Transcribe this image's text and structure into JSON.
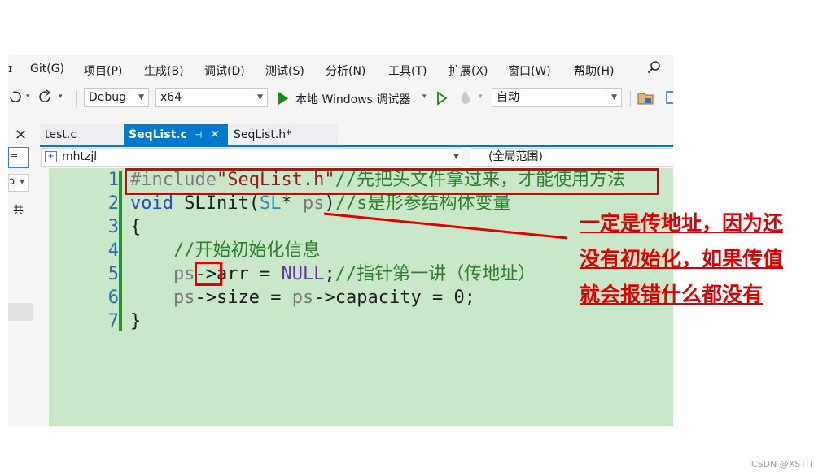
{
  "menu": [
    "Git(G)",
    "项目(P)",
    "生成(B)",
    "调试(D)",
    "测试(S)",
    "分析(N)",
    "工具(T)",
    "扩展(X)",
    "窗口(W)",
    "帮助(H)"
  ],
  "toolbar": {
    "config": "Debug",
    "platform": "x64",
    "run_label": "本地 Windows 调试器",
    "mode": "自动"
  },
  "tabs": [
    {
      "label": "test.c",
      "active": false
    },
    {
      "label": "SeqList.c",
      "active": true
    },
    {
      "label": "SeqList.h*",
      "active": false
    }
  ],
  "navbar": {
    "project": "mhtzjl",
    "scope": "(全局范围)"
  },
  "side": {
    "label": "共"
  },
  "editor": {
    "lines": [
      {
        "n": "1",
        "text": "#include\"SeqList.h\"//先把头文件拿过来，才能使用方法"
      },
      {
        "n": "2",
        "text": "void SLInit(SL* ps)//s是形参结构体变量"
      },
      {
        "n": "3",
        "text": "{"
      },
      {
        "n": "4",
        "text": "    //开始初始化信息"
      },
      {
        "n": "5",
        "text": "    ps->arr = NULL;//指针第一讲（传地址）"
      },
      {
        "n": "6",
        "text": "    ps->size = ps->capacity = 0;"
      },
      {
        "n": "7",
        "text": "}"
      }
    ]
  },
  "annotation": {
    "lines": [
      "一定是传地址，因为还",
      "没有初始化，如果传值",
      "就会报错什么都没有"
    ],
    "color": "#e00000"
  },
  "watermark": "CSDN @XSTIT"
}
